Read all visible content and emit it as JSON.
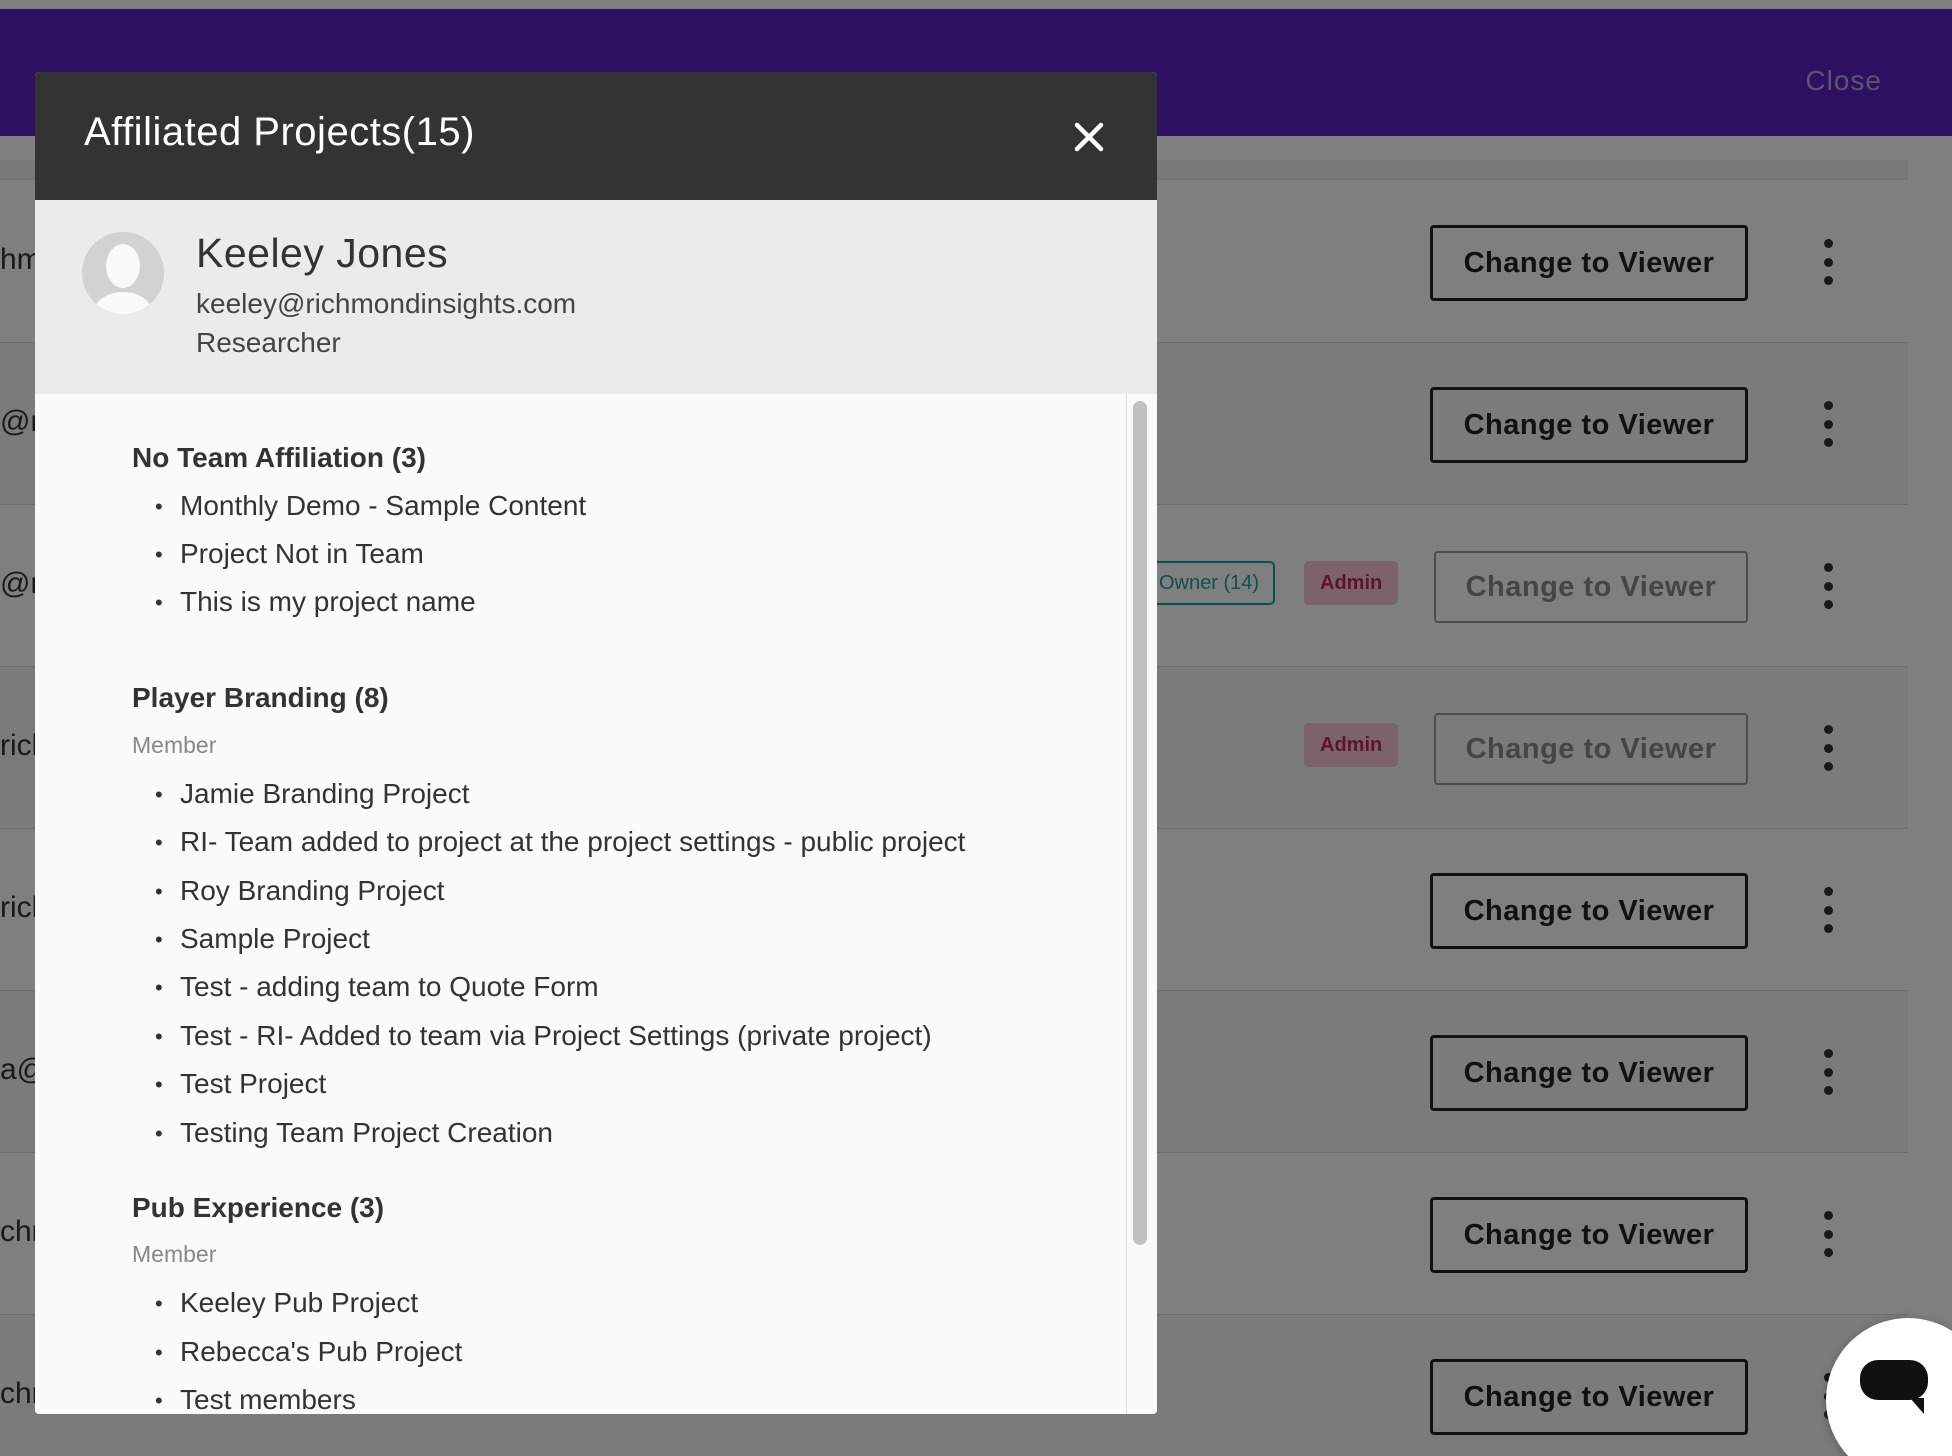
{
  "header": {
    "close_label": "Close"
  },
  "rows": [
    {
      "email_fragment": "hm",
      "button_label": "Change to Viewer"
    },
    {
      "email_fragment": "@ri",
      "button_label": "Change to Viewer"
    },
    {
      "email_fragment": "@r",
      "owner_badge": "Owner (14)",
      "admin_badge": "Admin",
      "button_label": "Change to Viewer"
    },
    {
      "email_fragment": "ricl",
      "admin_badge": "Admin",
      "button_label": "Change to Viewer"
    },
    {
      "email_fragment": "rich",
      "button_label": "Change to Viewer"
    },
    {
      "email_fragment": "a@",
      "button_label": "Change to Viewer"
    },
    {
      "email_fragment": "chr",
      "button_label": "Change to Viewer"
    },
    {
      "email_fragment": "chr",
      "button_label": "Change to Viewer"
    }
  ],
  "modal": {
    "title": "Affiliated Projects(15)",
    "close_icon": "close-icon",
    "user": {
      "name": "Keeley Jones",
      "email": "keeley@richmondinsights.com",
      "role": "Researcher"
    },
    "groups": [
      {
        "title": "No Team Affiliation (3)",
        "projects": [
          "Monthly Demo - Sample Content",
          "Project Not in Team",
          "This is my project name"
        ]
      },
      {
        "title": "Player Branding (8)",
        "role": "Member",
        "projects": [
          "Jamie Branding Project",
          "RI- Team added to project at the project settings - public project",
          "Roy Branding Project",
          "Sample Project",
          "Test - adding team to Quote Form",
          "Test - RI- Added to team via Project Settings (private project)",
          "Test Project",
          "Testing Team Project Creation"
        ]
      },
      {
        "title": "Pub Experience (3)",
        "role": "Member",
        "projects": [
          "Keeley Pub Project",
          "Rebecca's Pub Project",
          "Test members"
        ]
      }
    ]
  },
  "colors": {
    "header_purple": "#5b21c2",
    "modal_header": "#333333",
    "owner_badge": "#1aa39a",
    "admin_badge_text": "#c0275a",
    "admin_badge_bg": "#f7c6d3"
  },
  "chat_widget_icon": "chat-icon"
}
